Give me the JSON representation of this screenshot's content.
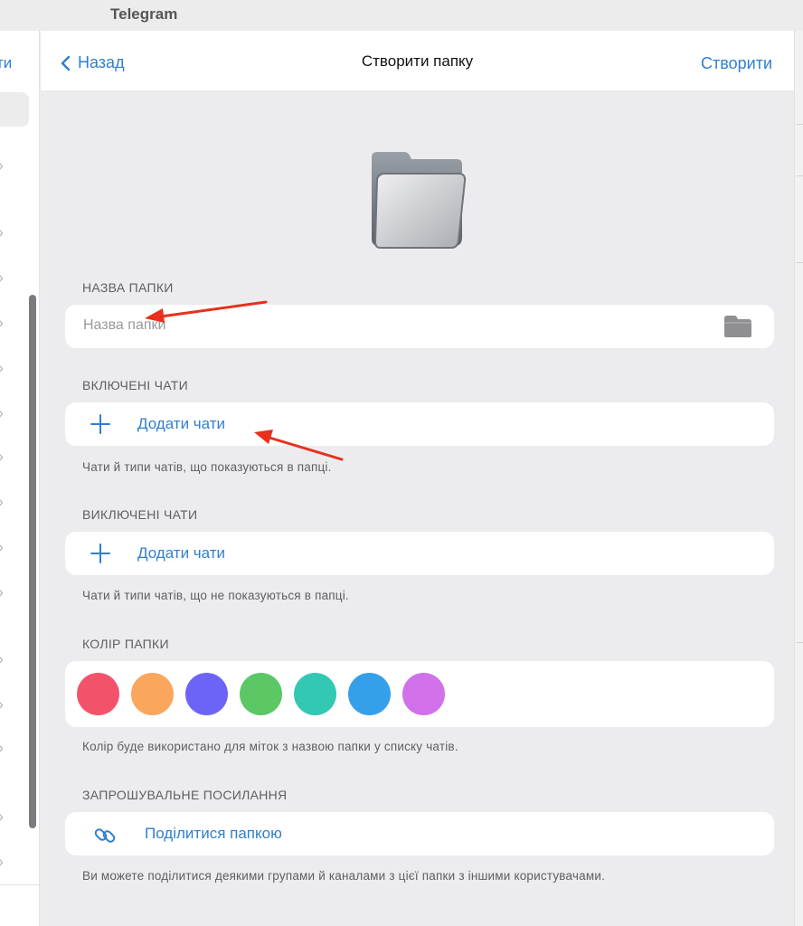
{
  "window": {
    "title": "Telegram"
  },
  "sidebar": {
    "edge_label": "ти"
  },
  "header": {
    "back_label": "Назад",
    "title": "Створити папку",
    "create_label": "Створити"
  },
  "folder_name": {
    "section_label": "НАЗВА ПАПКИ",
    "placeholder": "Назва папки",
    "value": ""
  },
  "included": {
    "section_label": "ВКЛЮЧЕНІ ЧАТИ",
    "add_label": "Додати чати",
    "hint": "Чати й типи чатів, що показуються в папці."
  },
  "excluded": {
    "section_label": "ВИКЛЮЧЕНІ ЧАТИ",
    "add_label": "Додати чати",
    "hint": "Чати й типи чатів, що не показуються в папці."
  },
  "folder_color": {
    "section_label": "КОЛІР ПАПКИ",
    "colors": [
      "#f2536b",
      "#fba65d",
      "#6c64f7",
      "#5bc765",
      "#33c8b4",
      "#35a0ea",
      "#d071ea"
    ],
    "hint": "Колір буде використано для міток з назвою папки у списку чатів."
  },
  "invite_link": {
    "section_label": "ЗАПРОШУВАЛЬНЕ ПОСИЛАННЯ",
    "share_label": "Поділитися папкою",
    "hint": "Ви можете поділитися деякими групами й каналами з цієї папки з іншими користувачами."
  },
  "theme": {
    "accent": "#2f7fd0",
    "annotation_arrow": "#e8301c"
  }
}
